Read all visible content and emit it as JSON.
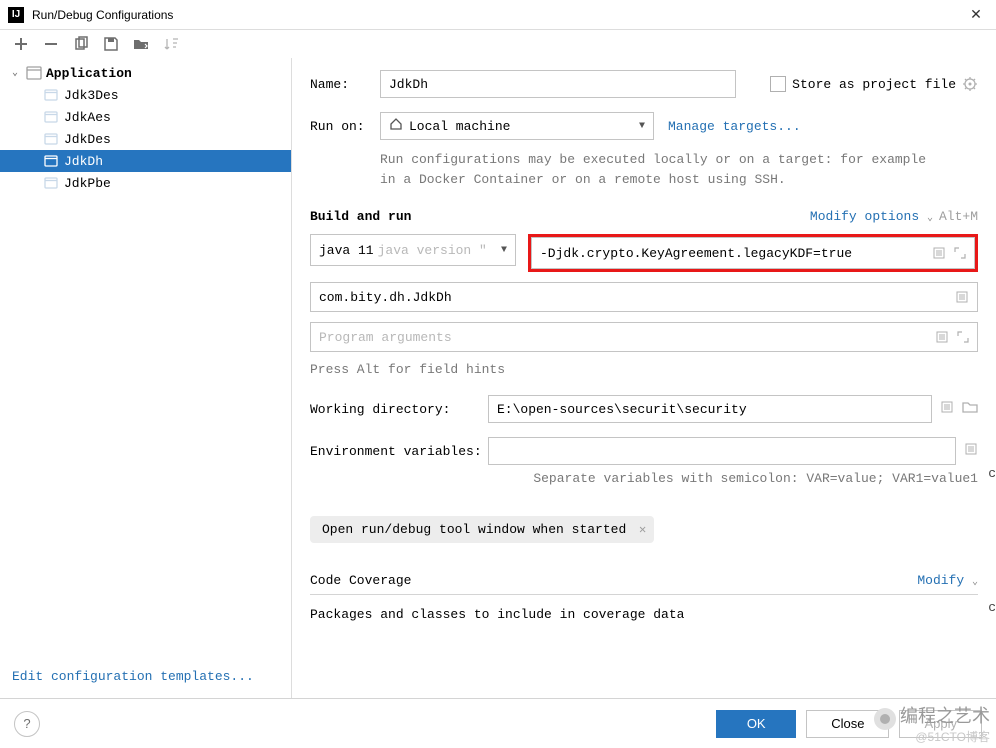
{
  "titlebar": {
    "title": "Run/Debug Configurations"
  },
  "tree": {
    "appNode": "Application",
    "items": [
      "Jdk3Des",
      "JdkAes",
      "JdkDes",
      "JdkDh",
      "JdkPbe"
    ],
    "selected": "JdkDh"
  },
  "sidebar": {
    "editTemplates": "Edit configuration templates..."
  },
  "form": {
    "nameLabel": "Name:",
    "nameValue": "JdkDh",
    "storeAsProject": "Store as project file",
    "runOnLabel": "Run on:",
    "runOnValue": "Local machine",
    "manageTargets": "Manage targets...",
    "runOnHint": "Run configurations may be executed locally or on a target: for example in a Docker Container or on a remote host using SSH.",
    "buildAndRun": "Build and run",
    "modifyOptions": "Modify options",
    "modifyShortcut": "Alt+M",
    "jdkValue": "java 11",
    "jdkHint": "java version \"",
    "vmOptions": "-Djdk.crypto.KeyAgreement.legacyKDF=true",
    "mainClass": "com.bity.dh.JdkDh",
    "programArgsPlaceholder": "Program arguments",
    "fieldHints": "Press Alt for field hints",
    "workingDirLabel": "Working directory:",
    "workingDir": "E:\\open-sources\\securit\\security",
    "envLabel": "Environment variables:",
    "envHint": "Separate variables with semicolon: VAR=value; VAR1=value1",
    "chipText": "Open run/debug tool window when started",
    "codeCoverage": "Code Coverage",
    "modify": "Modify",
    "coverageSubtitle": "Packages and classes to include in coverage data"
  },
  "footer": {
    "ok": "OK",
    "close": "Close",
    "apply": "Apply",
    "help": "?"
  },
  "watermark": {
    "line1": "编程之艺术",
    "line2": "@51CTO博客"
  },
  "edge": {
    "c": "c",
    "c2": "c"
  }
}
